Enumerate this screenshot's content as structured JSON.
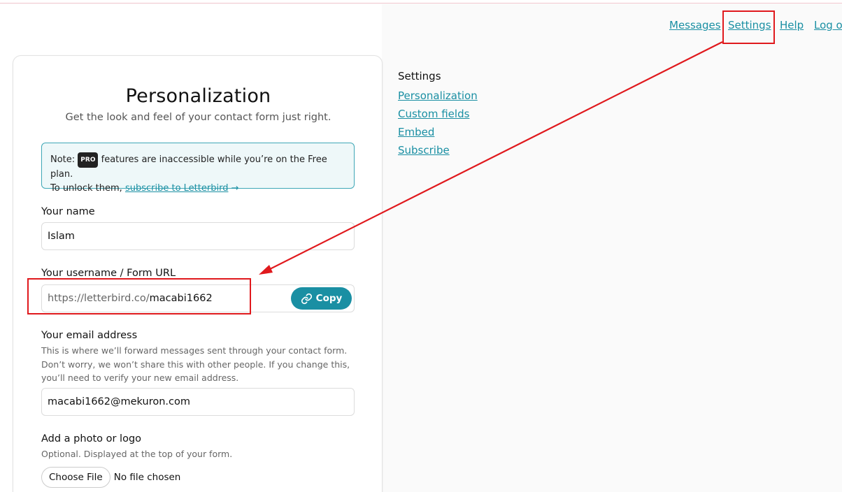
{
  "top_nav": [
    "Messages",
    "Settings",
    "Help",
    "Log o"
  ],
  "card": {
    "title": "Personalization",
    "subtitle": "Get the look and feel of your contact form just right.",
    "note": {
      "prefix": "Note:",
      "badge": "PRO",
      "text": "features are inaccessible while you’re on the Free plan.",
      "line2": "To unlock them,",
      "link": "subscribe to Letterbird",
      "arrow": "→"
    },
    "name": {
      "label": "Your name",
      "value": "Islam"
    },
    "username": {
      "label": "Your username / Form URL",
      "prefix": "https://letterbird.co/",
      "value": "macabi1662",
      "copy_label": "Copy"
    },
    "email": {
      "label": "Your email address",
      "help": "This is where we’ll forward messages sent through your contact form. Don’t worry, we won’t share this with other people. If you change this, you’ll need to verify your new email address.",
      "value": "macabi1662@mekuron.com"
    },
    "photo": {
      "label": "Add a photo or logo",
      "help": "Optional. Displayed at the top of your form.",
      "button": "Choose File",
      "status": "No file chosen"
    }
  },
  "settings_nav": {
    "heading": "Settings",
    "items": [
      "Personalization",
      "Custom fields",
      "Embed",
      "Subscribe"
    ]
  },
  "colors": {
    "accent": "#1a8fa3",
    "annotation": "#e0191d",
    "note_bg": "#eef8f9"
  },
  "icons": {
    "copy": "link-icon",
    "arrow": "arrow-right-icon"
  }
}
